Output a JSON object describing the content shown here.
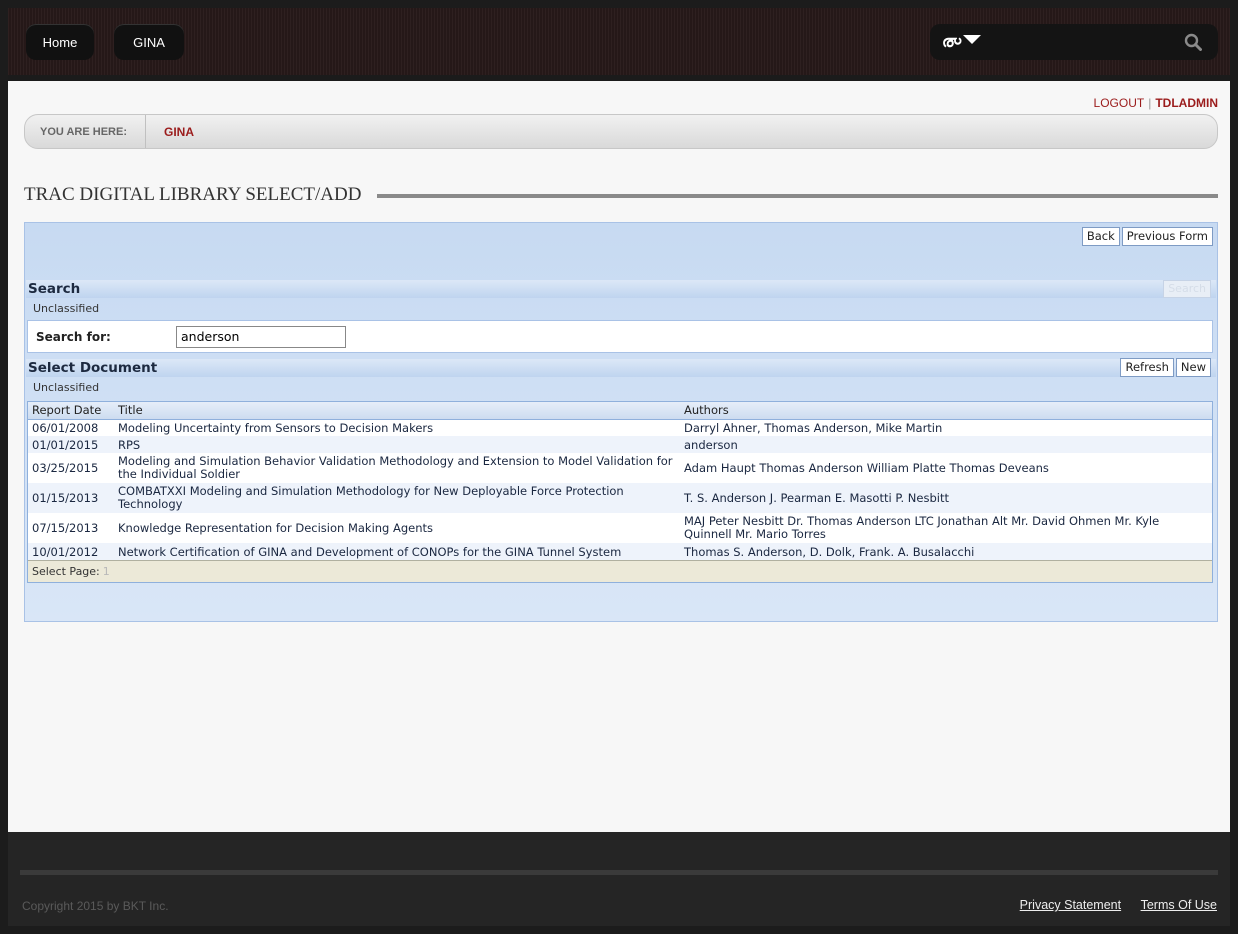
{
  "nav": {
    "home": "Home",
    "gina": "GINA",
    "lang_glyph": "൞"
  },
  "user": {
    "logout": "LOGOUT",
    "separator": "|",
    "username": "TDLADMIN"
  },
  "breadcrumb": {
    "label": "YOU ARE HERE:",
    "current": "GINA"
  },
  "page_title": "TRAC DIGITAL LIBRARY SELECT/ADD",
  "toolbar": {
    "back": "Back",
    "previous_form": "Previous Form"
  },
  "search_section": {
    "title": "Search",
    "classification": "Unclassified",
    "search_button": "Search",
    "search_for_label": "Search for:",
    "search_value": "anderson"
  },
  "select_section": {
    "title": "Select Document",
    "classification": "Unclassified",
    "refresh": "Refresh",
    "new": "New",
    "columns": [
      "Report Date",
      "Title",
      "Authors"
    ],
    "rows": [
      {
        "date": "06/01/2008",
        "title": "Modeling Uncertainty from Sensors to Decision Makers",
        "authors": "Darryl Ahner, Thomas Anderson, Mike Martin"
      },
      {
        "date": "01/01/2015",
        "title": "RPS",
        "authors": "anderson"
      },
      {
        "date": "03/25/2015",
        "title": "Modeling and Simulation Behavior Validation Methodology and Extension to Model Validation for the Individual Soldier",
        "authors": "Adam Haupt Thomas Anderson William Platte Thomas Deveans"
      },
      {
        "date": "01/15/2013",
        "title": "COMBATXXI Modeling and Simulation Methodology for New Deployable Force Protection Technology",
        "authors": "T. S. Anderson J. Pearman E. Masotti P. Nesbitt"
      },
      {
        "date": "07/15/2013",
        "title": "Knowledge Representation for Decision Making Agents",
        "authors": "MAJ Peter Nesbitt Dr. Thomas Anderson LTC Jonathan Alt Mr. David Ohmen Mr. Kyle Quinnell Mr. Mario Torres"
      },
      {
        "date": "10/01/2012",
        "title": "Network Certification of GINA and Development of CONOPs for the GINA Tunnel System",
        "authors": "Thomas S. Anderson, D. Dolk, Frank. A. Busalacchi"
      }
    ],
    "pager_label": "Select Page:",
    "pager_page": "1"
  },
  "footer": {
    "copyright": "Copyright 2015 by BKT Inc.",
    "privacy": "Privacy Statement",
    "terms": "Terms Of Use"
  }
}
